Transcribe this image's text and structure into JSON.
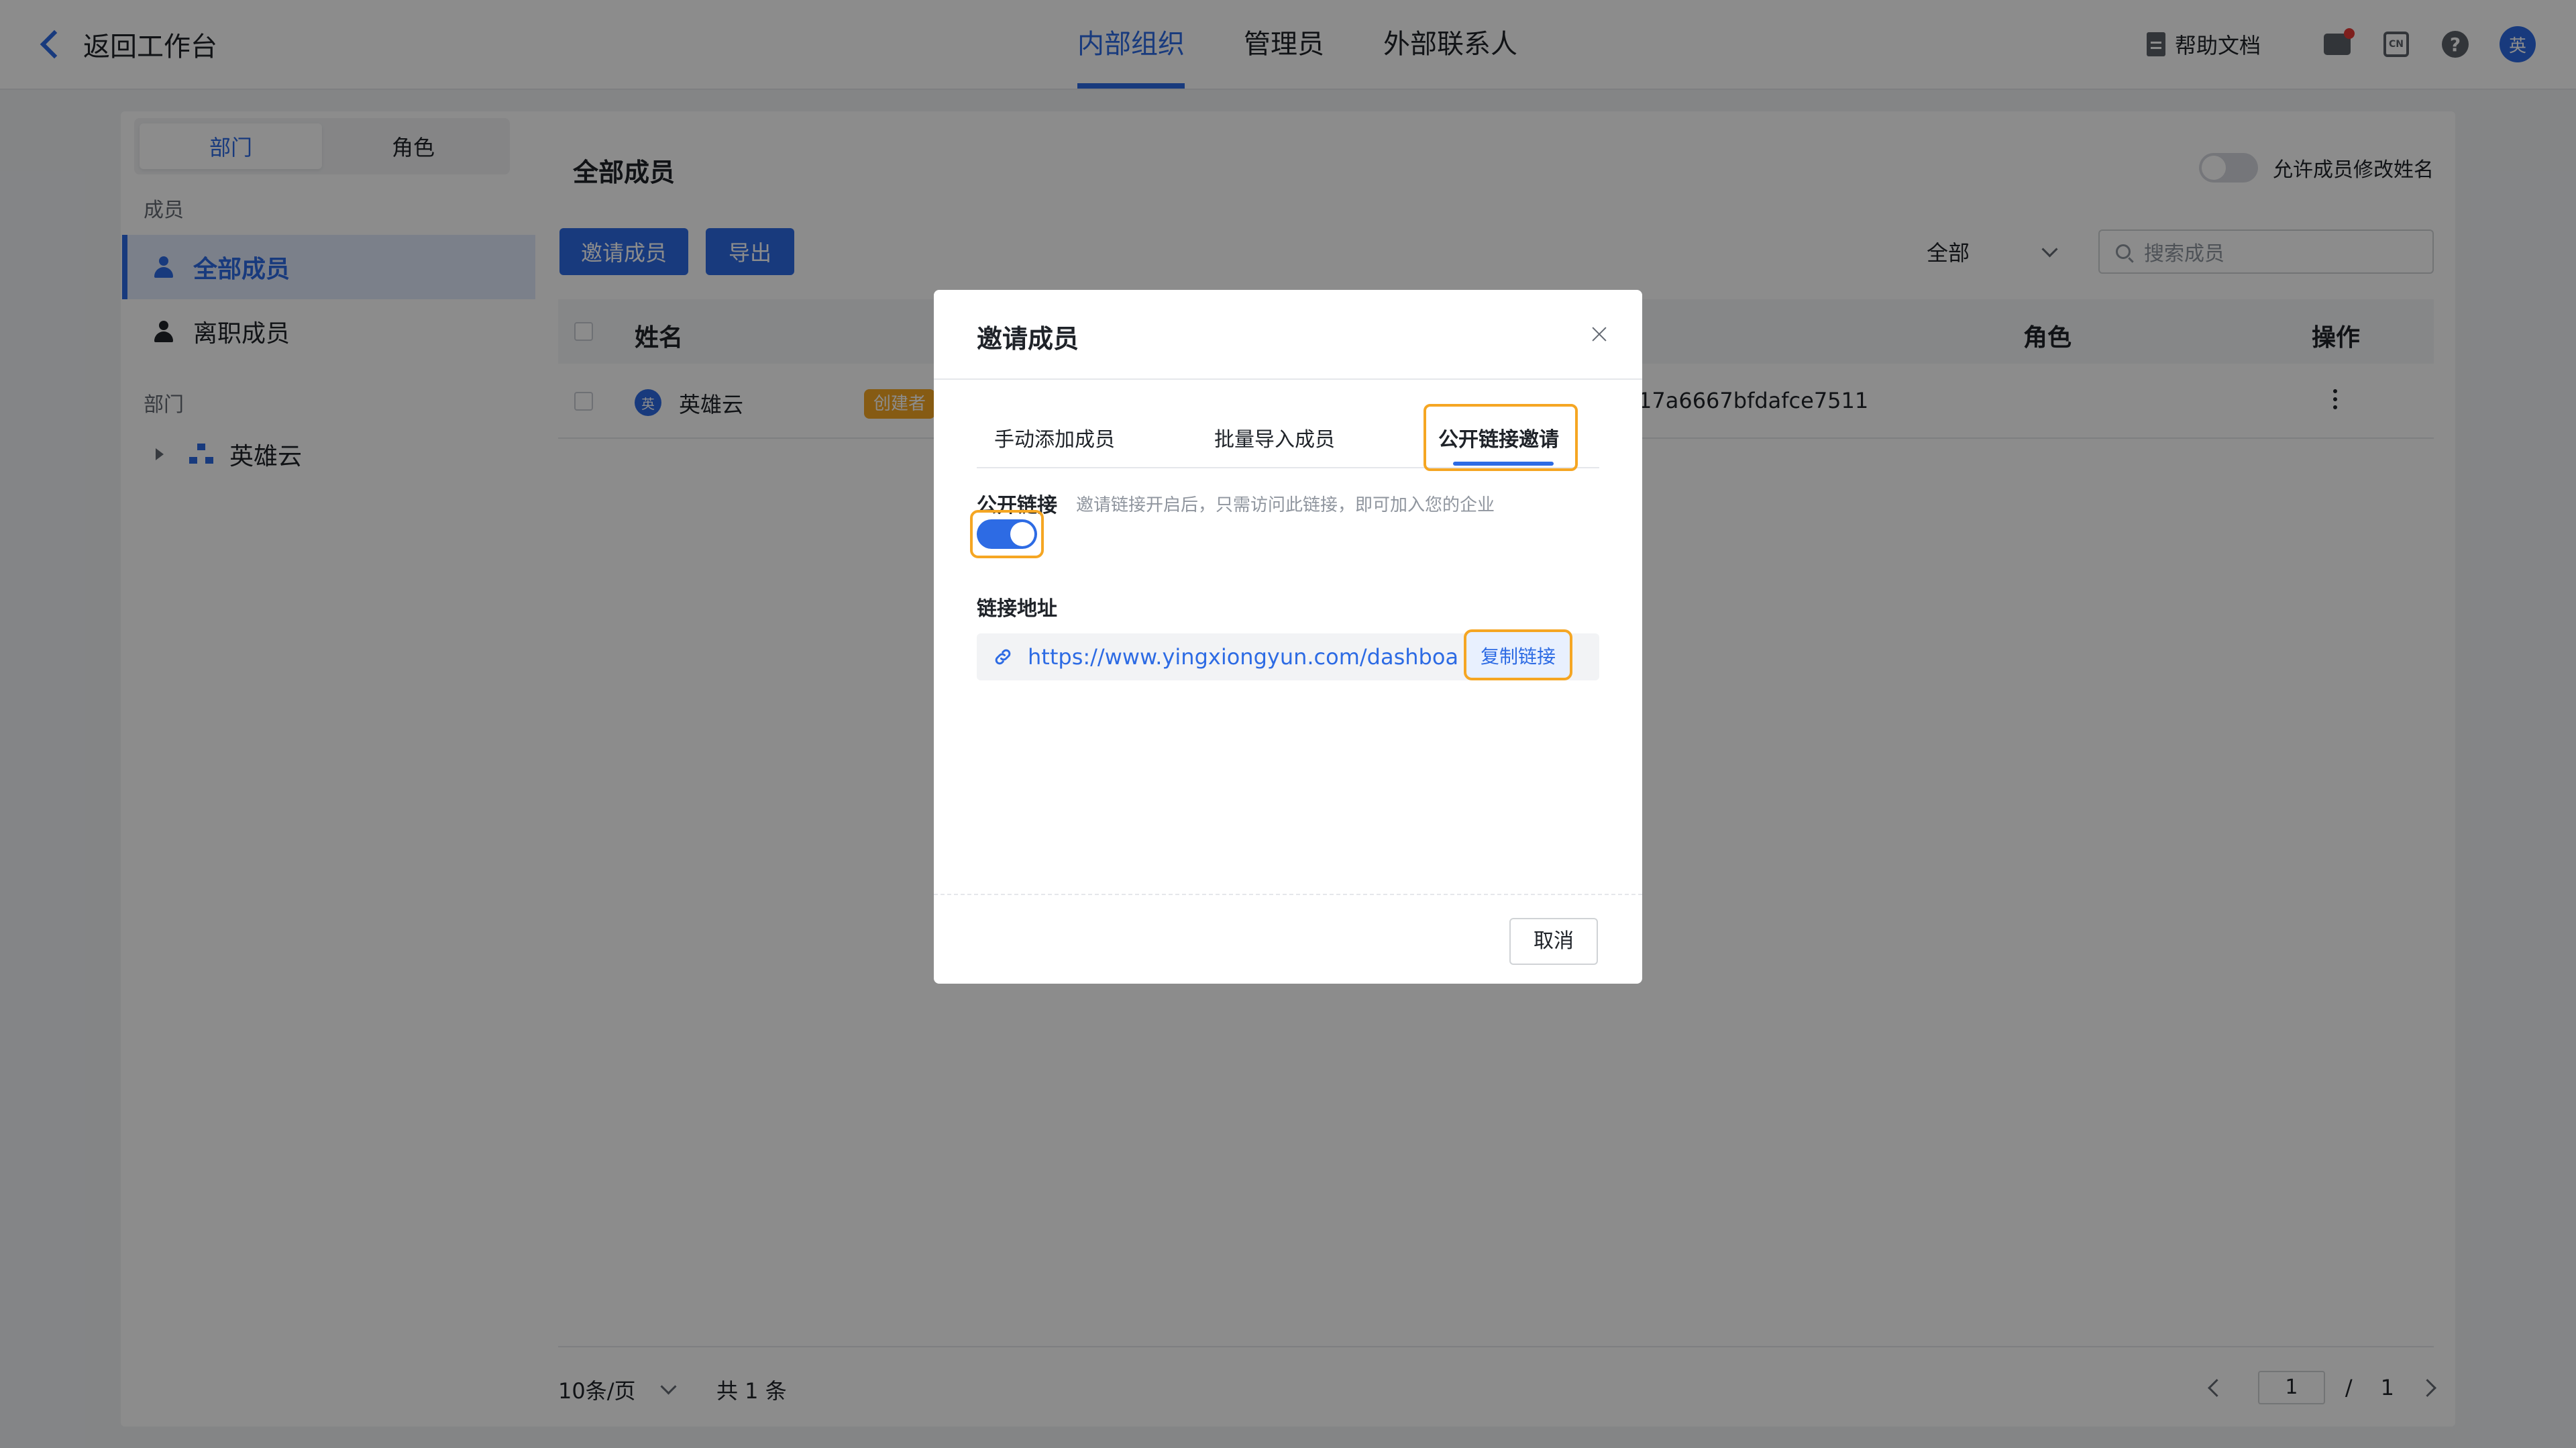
{
  "topbar": {
    "back_label": "返回工作台",
    "nav": [
      {
        "label": "内部组织",
        "active": true
      },
      {
        "label": "管理员",
        "active": false
      },
      {
        "label": "外部联系人",
        "active": false
      }
    ],
    "help_doc": "帮助文档",
    "lang_badge": "CN",
    "help_glyph": "?",
    "avatar": "英"
  },
  "sidebar": {
    "segments": [
      "部门",
      "角色"
    ],
    "members_group": "成员",
    "items": [
      {
        "label": "全部成员",
        "active": true
      },
      {
        "label": "离职成员",
        "active": false
      }
    ],
    "dept_group": "部门",
    "tree_root": "英雄云"
  },
  "content": {
    "title": "全部成员",
    "allow_rename": "允许成员修改姓名",
    "invite_button": "邀请成员",
    "export_button": "导出",
    "filter_value": "全部",
    "search_placeholder": "搜索成员",
    "columns": {
      "name": "姓名",
      "role": "角色",
      "action": "操作"
    },
    "rows": [
      {
        "avatar": "英",
        "name": "英雄云",
        "badge": "创建者",
        "id": "17a6667bfdafce7511"
      }
    ],
    "pager": {
      "page_size": "10条/页",
      "total": "共 1 条",
      "current": "1",
      "sep": "/",
      "pages": "1"
    }
  },
  "modal": {
    "title": "邀请成员",
    "tabs": [
      {
        "label": "手动添加成员",
        "active": false
      },
      {
        "label": "批量导入成员",
        "active": false
      },
      {
        "label": "公开链接邀请",
        "active": true
      }
    ],
    "public_link_label": "公开链接",
    "public_link_hint": "邀请链接开启后，只需访问此链接，即可加入您的企业",
    "public_link_enabled": true,
    "link_address_label": "链接地址",
    "link_url": "https://www.yingxiongyun.com/dashboa...",
    "copy_button": "复制链接",
    "cancel_button": "取消"
  },
  "colors": {
    "accent": "#2d6be4",
    "highlight": "#f5a623",
    "badge": "#f5a623"
  }
}
